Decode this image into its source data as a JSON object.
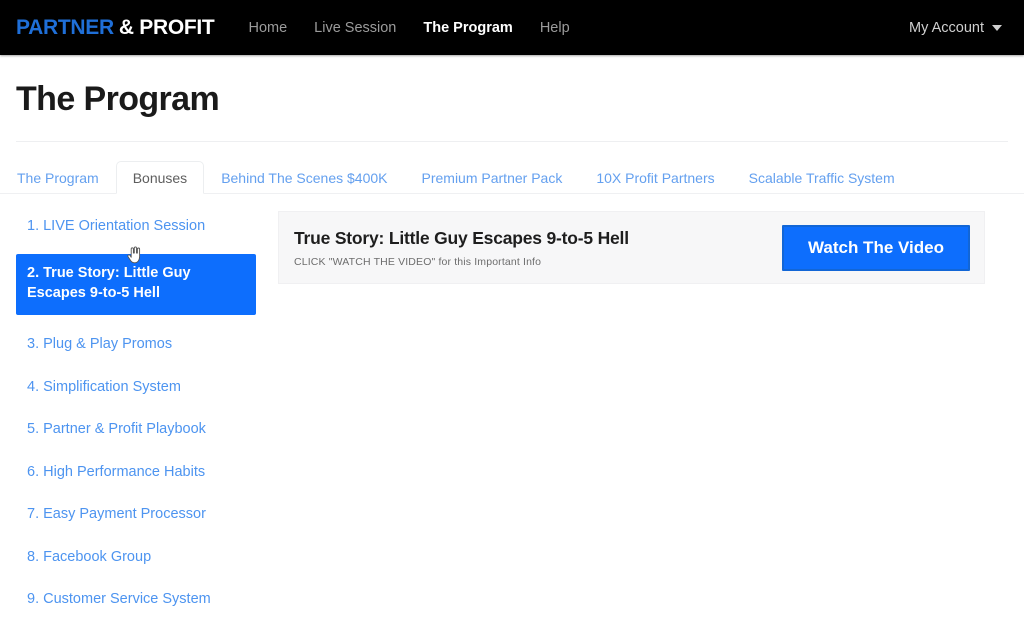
{
  "header": {
    "logo": {
      "part1": "PARTNER",
      "part2": "& PROFIT"
    },
    "nav": [
      {
        "label": "Home",
        "active": false
      },
      {
        "label": "Live Session",
        "active": false
      },
      {
        "label": "The Program",
        "active": true
      },
      {
        "label": "Help",
        "active": false
      }
    ],
    "account_label": "My Account",
    "caret_icon": "chevron-down-icon",
    "bar_color": "#000000",
    "logo_blue": "#1f6fd8"
  },
  "page": {
    "title": "The Program"
  },
  "tabs": [
    {
      "label": "The Program",
      "active": false
    },
    {
      "label": "Bonuses",
      "active": true
    },
    {
      "label": "Behind The Scenes $400K",
      "active": false
    },
    {
      "label": "Premium Partner Pack",
      "active": false
    },
    {
      "label": "10X Profit Partners",
      "active": false
    },
    {
      "label": "Scalable Traffic System",
      "active": false
    }
  ],
  "sidebar": {
    "items": [
      {
        "label": "1. LIVE Orientation Session",
        "active": false
      },
      {
        "label": "2. True Story: Little Guy Escapes 9-to-5 Hell",
        "active": true
      },
      {
        "label": "3. Plug & Play Promos",
        "active": false
      },
      {
        "label": "4. Simplification System",
        "active": false
      },
      {
        "label": "5. Partner & Profit Playbook",
        "active": false
      },
      {
        "label": "6. High Performance Habits",
        "active": false
      },
      {
        "label": "7. Easy Payment Processor",
        "active": false
      },
      {
        "label": "8. Facebook Group",
        "active": false
      },
      {
        "label": "9. Customer Service System",
        "active": false
      }
    ],
    "active_bg": "#0d6efd",
    "link_color": "#4d94f0"
  },
  "main": {
    "card": {
      "title": "True Story: Little Guy Escapes 9-to-5 Hell",
      "subtitle": "CLICK \"WATCH THE VIDEO\" for this Important Info",
      "button_label": "Watch The Video",
      "button_color": "#0d6efd",
      "bg_color": "#f7f7f8"
    }
  },
  "cursor": {
    "icon": "pointer-hand-cursor"
  }
}
